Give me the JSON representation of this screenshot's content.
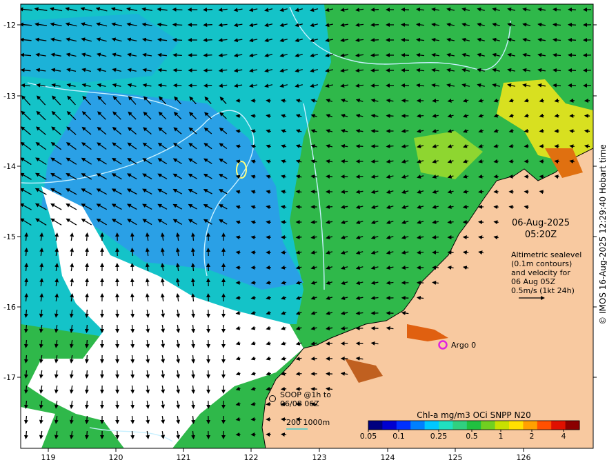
{
  "map": {
    "lon_ticks": [
      "119",
      "120",
      "121",
      "122",
      "123",
      "124",
      "125",
      "126"
    ],
    "lat_ticks": [
      "-12",
      "-13",
      "-14",
      "-15",
      "-16",
      "-17"
    ]
  },
  "info": {
    "date": "06-Aug-2025",
    "time": "05:20Z",
    "altimetry_lines": [
      "Altimetric sealevel",
      "(0.1m contours)",
      "and velocity for",
      "06 Aug 05Z",
      "0.5m/s (1kt 24h)"
    ]
  },
  "markers": {
    "argo_label": "Argo 0",
    "soop_line1": "SOOP @1h to",
    "soop_line2": "06/08 06Z",
    "isobath_label": "200  1000m"
  },
  "colorbar": {
    "title": "Chl-a mg/m3 OCi SNPP N20",
    "ticks": [
      "0.05",
      "0.1",
      "0.25",
      "0.5",
      "1",
      "2",
      "4"
    ],
    "colors": [
      "#00007f",
      "#0000d0",
      "#0030ff",
      "#0080ff",
      "#00c8ff",
      "#20e0c0",
      "#30d080",
      "#20c040",
      "#70d020",
      "#c8e000",
      "#ffe000",
      "#ffa000",
      "#ff5000",
      "#e01000",
      "#8b0000"
    ]
  },
  "credit": "© IMOS 16-Aug-2025 12:29:40 Hobart time",
  "colors": {
    "land": "#f8c9a0",
    "ocean_green": "#2fb84a",
    "ocean_cyan": "#14c3c8",
    "ocean_blue": "#2aa0e6",
    "contour": "#c8f0ff",
    "argo": "#e020e0",
    "isobath": "#40d0d0"
  }
}
